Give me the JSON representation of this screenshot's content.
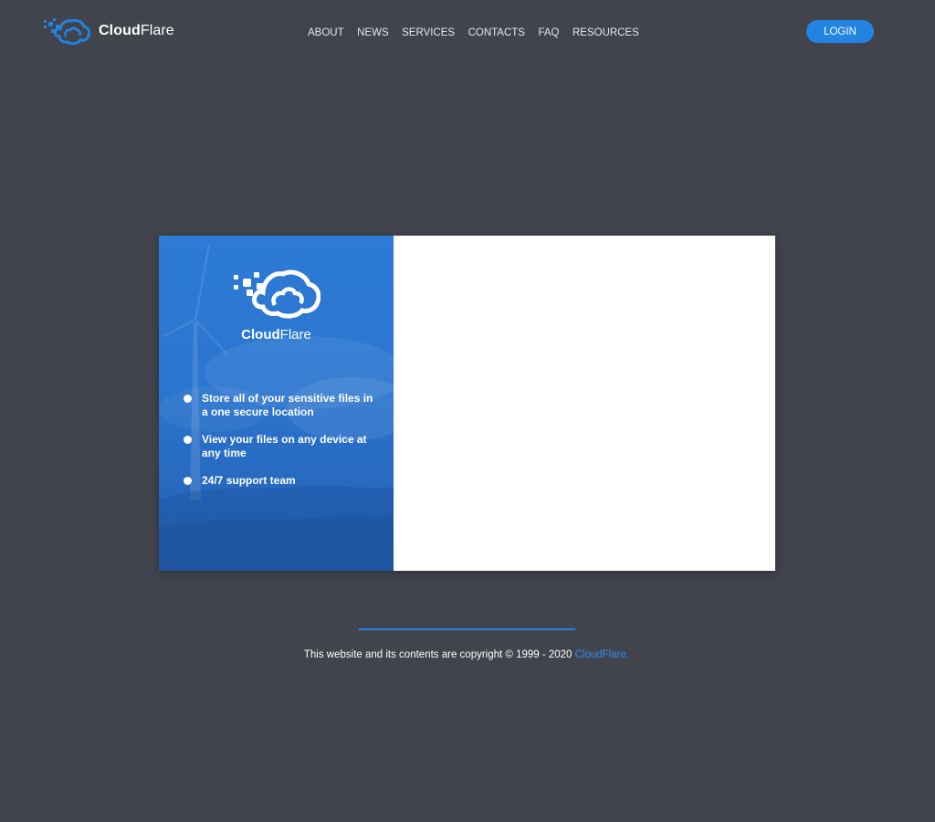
{
  "header": {
    "logo": {
      "bold": "Cloud",
      "light": "Flare"
    },
    "nav": [
      "ABOUT",
      "NEWS",
      "SERVICES",
      "CONTACTS",
      "FAQ",
      "RESOURCES"
    ],
    "login_label": "LOGIN"
  },
  "card": {
    "logo": {
      "bold": "Cloud",
      "light": "Flare"
    },
    "features": [
      "Store all of your sensitive files in a one secure location",
      "View your files on any device at any time",
      "24/7 support team"
    ]
  },
  "footer": {
    "text": "This website and its contents are copyright © 1999 - 2020 ",
    "link": "CloudFlare."
  },
  "colors": {
    "background": "#42444d",
    "accent": "#2383e2",
    "card_panel": "#2b75cf",
    "white": "#ffffff"
  },
  "icons": [
    "cloud-logo-icon",
    "bullet-dot-icon"
  ]
}
